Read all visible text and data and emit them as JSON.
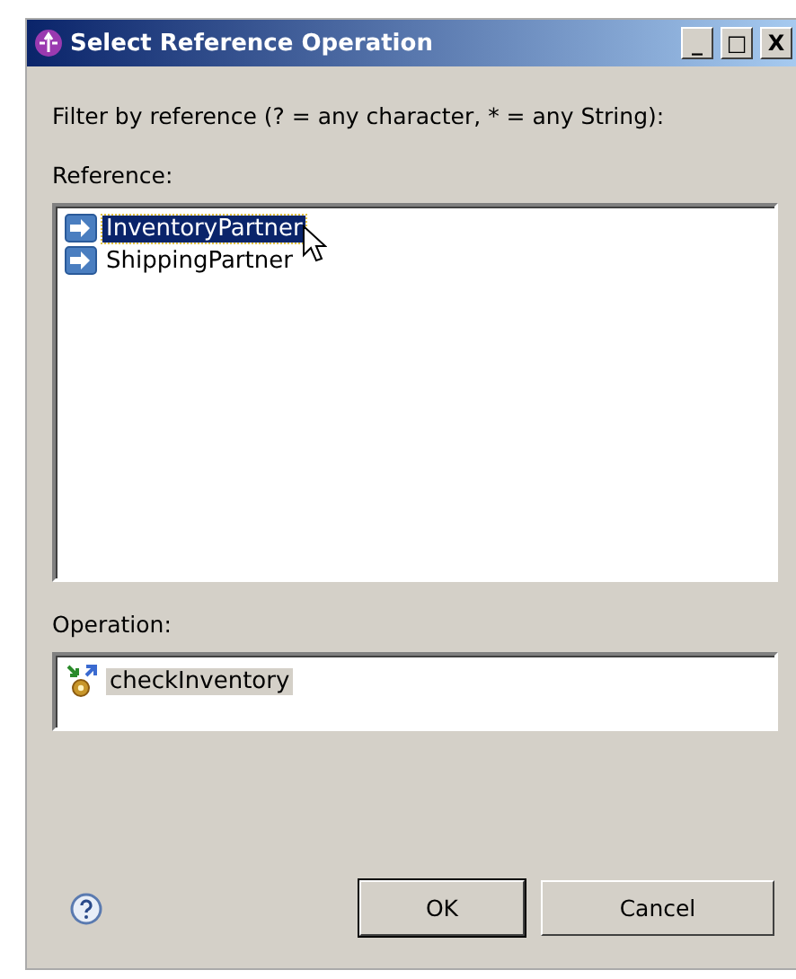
{
  "window": {
    "title": "Select Reference Operation",
    "controls": [
      "_",
      "□",
      "X"
    ]
  },
  "filter_label": "Filter by reference (? = any character, * = any String):",
  "reference": {
    "label": "Reference:",
    "items": [
      {
        "text": "InventoryPartner",
        "selected": true
      },
      {
        "text": "ShippingPartner",
        "selected": false
      }
    ]
  },
  "operation": {
    "label": "Operation:",
    "items": [
      {
        "text": "checkInventory",
        "selected": true
      }
    ]
  },
  "buttons": [
    {
      "label": "OK",
      "default": true
    },
    {
      "label": "Cancel",
      "default": false
    }
  ]
}
